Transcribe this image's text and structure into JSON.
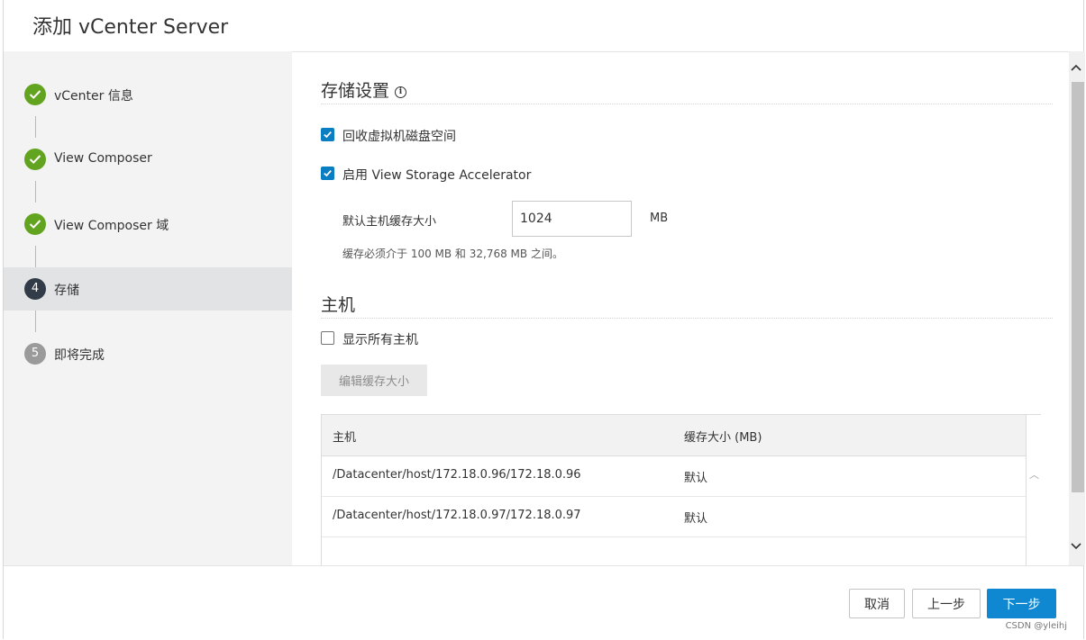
{
  "dialog": {
    "title": "添加 vCenter Server"
  },
  "steps": [
    {
      "label": "vCenter 信息",
      "state": "done",
      "number": ""
    },
    {
      "label": "View Composer",
      "state": "done",
      "number": ""
    },
    {
      "label": "View Composer 域",
      "state": "done",
      "number": ""
    },
    {
      "label": "存储",
      "state": "current",
      "number": "4"
    },
    {
      "label": "即将完成",
      "state": "pending",
      "number": "5"
    }
  ],
  "storage": {
    "title": "存储设置",
    "info_icon": "i",
    "reclaim_label": "回收虚拟机磁盘空间",
    "reclaim_checked": true,
    "vsa_label": "启用 View Storage Accelerator",
    "vsa_checked": true,
    "cache_label": "默认主机缓存大小",
    "cache_value": "1024",
    "cache_unit": "MB",
    "cache_hint": "缓存必须介于 100 MB 和 32,768 MB 之间。"
  },
  "hosts": {
    "title": "主机",
    "show_all_label": "显示所有主机",
    "show_all_checked": false,
    "edit_button": "编辑缓存大小",
    "columns": [
      "主机",
      "缓存大小 (MB)"
    ],
    "rows": [
      [
        "/Datacenter/host/172.18.0.96/172.18.0.96",
        "默认"
      ],
      [
        "/Datacenter/host/172.18.0.97/172.18.0.97",
        "默认"
      ]
    ]
  },
  "footer": {
    "cancel": "取消",
    "back": "上一步",
    "next": "下一步"
  },
  "watermark": "CSDN @yleihj",
  "colors": {
    "accent": "#0f87d1",
    "checkbox": "#0a7ec2",
    "done": "#62a420",
    "current": "#313c48",
    "pending": "#9a9a9a"
  }
}
